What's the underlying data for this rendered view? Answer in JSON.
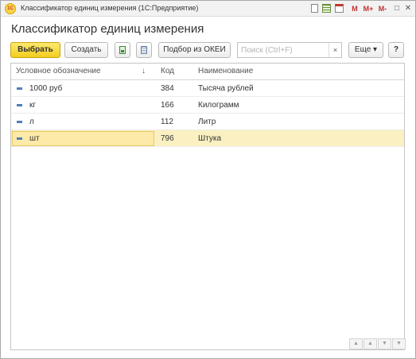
{
  "window": {
    "logo_text": "1С",
    "title": "Классификатор единиц измерения  (1С:Предприятие)",
    "m_label": "M",
    "mplus_label": "M+",
    "mminus_label": "M-",
    "restore_glyph": "□",
    "close_glyph": "✕"
  },
  "page": {
    "title": "Классификатор единиц измерения"
  },
  "toolbar": {
    "select_label": "Выбрать",
    "create_label": "Создать",
    "okei_label": "Подбор из ОКЕИ",
    "more_label": "Еще ▾",
    "help_label": "?"
  },
  "search": {
    "placeholder": "Поиск (Ctrl+F)",
    "value": "",
    "clear_glyph": "×"
  },
  "table": {
    "columns": [
      "Условное обозначение",
      "Код",
      "Наименование"
    ],
    "sort_glyph": "↓",
    "rows": [
      {
        "symbol": "1000 руб",
        "code": "384",
        "name": "Тысяча рублей"
      },
      {
        "symbol": "кг",
        "code": "166",
        "name": "Килограмм"
      },
      {
        "symbol": "л",
        "code": "112",
        "name": "Литр"
      },
      {
        "symbol": "шт",
        "code": "796",
        "name": "Штука"
      }
    ],
    "selected_row": 3
  },
  "nav": {
    "first": "▲",
    "prev": "▲",
    "next": "▼",
    "last": "▼"
  },
  "colors": {
    "primary_button": "#f3cd1e",
    "selected_row": "#fbf0c2",
    "row_icon": "#4f7fb8"
  }
}
